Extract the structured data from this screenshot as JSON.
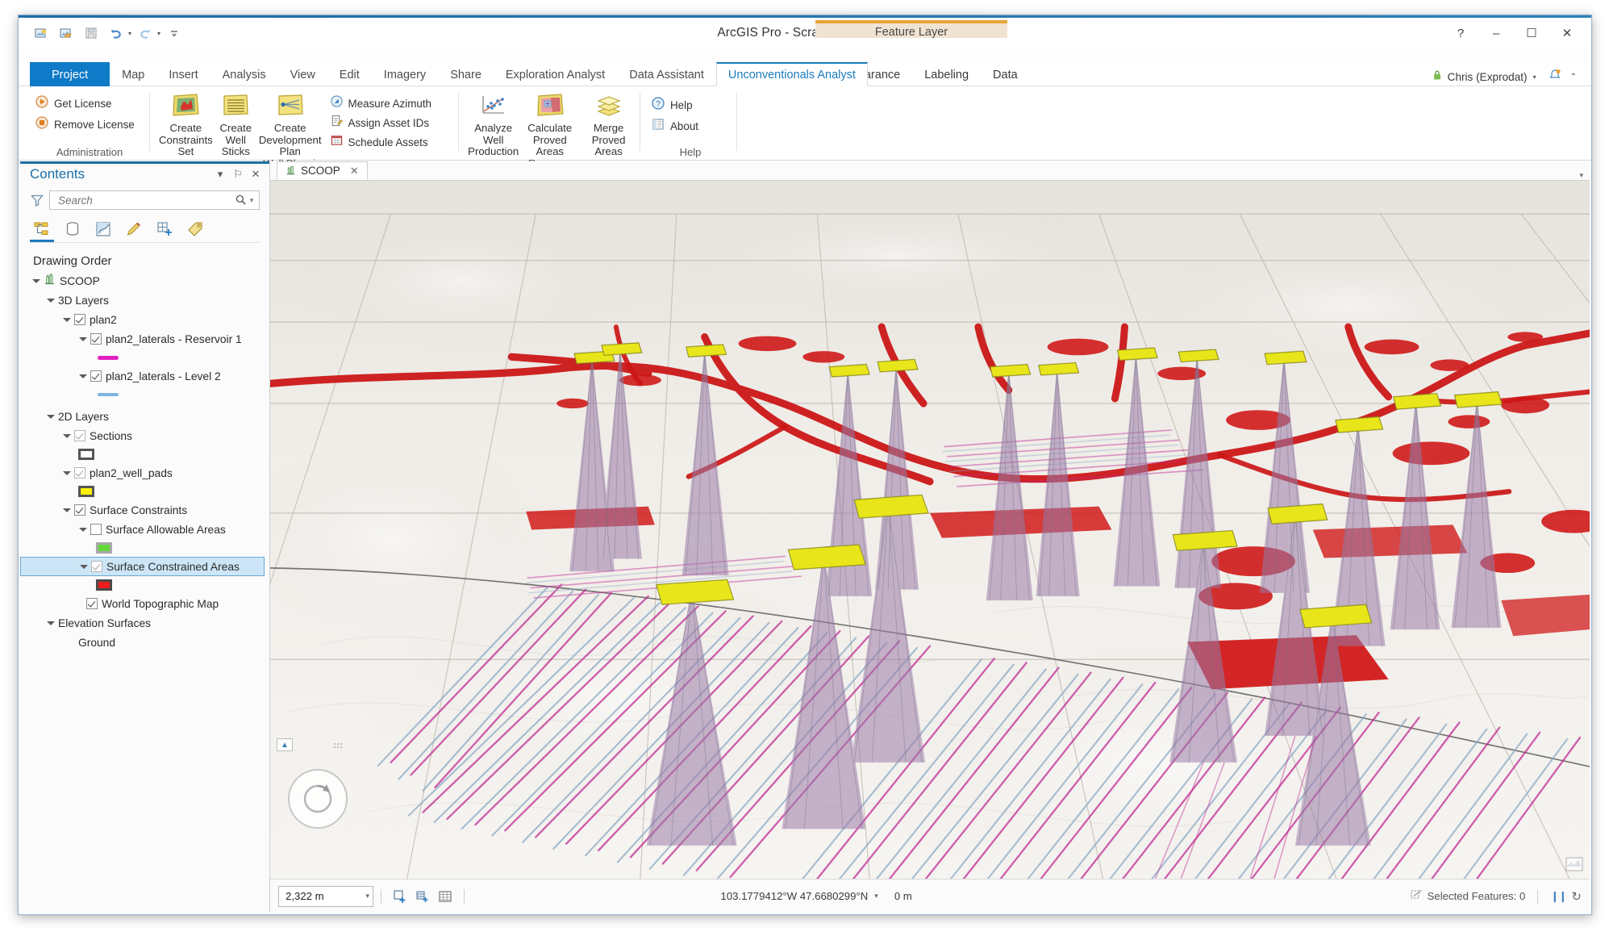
{
  "window": {
    "title": "ArcGIS Pro - Scratch - SCOOP",
    "help_glyph": "?",
    "minimize_glyph": "–",
    "maximize_glyph": "☐",
    "close_glyph": "✕",
    "account": "Chris (Exprodat)",
    "account_caret": "▾",
    "ribbon_collapse": "⌃"
  },
  "quick_access": [
    {
      "name": "new-project",
      "icon": "new-project-icon"
    },
    {
      "name": "open-project",
      "icon": "open-project-icon"
    },
    {
      "name": "save-project",
      "icon": "save-project-icon"
    },
    {
      "name": "undo",
      "icon": "undo-icon"
    },
    {
      "name": "redo",
      "icon": "redo-icon"
    },
    {
      "name": "customize-qat",
      "icon": "chevron-down-icon"
    }
  ],
  "tabs": [
    {
      "label": "Project",
      "state": "project"
    },
    {
      "label": "Map",
      "state": "normal"
    },
    {
      "label": "Insert",
      "state": "normal"
    },
    {
      "label": "Analysis",
      "state": "normal"
    },
    {
      "label": "View",
      "state": "normal"
    },
    {
      "label": "Edit",
      "state": "normal"
    },
    {
      "label": "Imagery",
      "state": "normal"
    },
    {
      "label": "Share",
      "state": "normal"
    },
    {
      "label": "Exploration Analyst",
      "state": "normal"
    },
    {
      "label": "Data Assistant",
      "state": "normal"
    },
    {
      "label": "Unconventionals Analyst",
      "state": "active"
    }
  ],
  "contextual": {
    "group_label": "Feature Layer",
    "tabs": [
      {
        "label": "Appearance"
      },
      {
        "label": "Labeling"
      },
      {
        "label": "Data"
      }
    ]
  },
  "ribbon": {
    "groups": [
      {
        "name": "Administration",
        "label": "Administration",
        "small_buttons": [
          {
            "label": "Get License",
            "icon": "play-circle-icon"
          },
          {
            "label": "Remove License",
            "icon": "stop-circle-icon"
          }
        ]
      },
      {
        "name": "Well Planning",
        "label": "Well Planning",
        "big_buttons": [
          {
            "label": "Create\nConstraints Set",
            "line1": "Create",
            "line2": "Constraints Set",
            "icon": "constraints-set-icon"
          },
          {
            "label": "Create\nWell Sticks",
            "line1": "Create",
            "line2": "Well Sticks",
            "icon": "well-sticks-icon"
          },
          {
            "label": "Create\nDevelopment Plan",
            "line1": "Create",
            "line2": "Development Plan",
            "icon": "development-plan-icon"
          }
        ],
        "small_buttons": [
          {
            "label": "Measure Azimuth",
            "icon": "compass-icon"
          },
          {
            "label": "Assign Asset IDs",
            "icon": "assign-asset-icon"
          },
          {
            "label": "Schedule Assets",
            "icon": "calendar-icon"
          }
        ]
      },
      {
        "name": "Reserves",
        "label": "Reserves",
        "big_buttons": [
          {
            "line1": "Analyze Well",
            "line2": "Production",
            "icon": "scatter-plot-icon"
          },
          {
            "line1": "Calculate",
            "line2": "Proved Areas",
            "icon": "proved-areas-icon"
          },
          {
            "line1": "Merge",
            "line2": "Proved Areas",
            "icon": "merge-layers-icon"
          }
        ]
      },
      {
        "name": "Help",
        "label": "Help",
        "small_buttons": [
          {
            "label": "Help",
            "icon": "help-circle-icon"
          },
          {
            "label": "About",
            "icon": "about-icon"
          }
        ]
      }
    ]
  },
  "contents": {
    "title": "Contents",
    "header_buttons": [
      {
        "name": "menu",
        "glyph": "▾"
      },
      {
        "name": "pin",
        "glyph": "⚐"
      },
      {
        "name": "close",
        "glyph": "✕"
      }
    ],
    "search": {
      "placeholder": "Search",
      "value": "",
      "filter_icon": "filter-icon",
      "search_icon": "search-icon",
      "caret": "▾"
    },
    "view_tabs": [
      {
        "name": "list-by-drawing-order",
        "icon": "drawing-order-icon",
        "selected": true
      },
      {
        "name": "list-by-data-source",
        "icon": "data-source-icon",
        "selected": false
      },
      {
        "name": "list-by-selection",
        "icon": "selection-icon",
        "selected": false
      },
      {
        "name": "list-by-editing",
        "icon": "editing-icon",
        "selected": false
      },
      {
        "name": "list-by-snapping",
        "icon": "snapping-icon",
        "selected": false
      },
      {
        "name": "list-by-labeling",
        "icon": "labeling-icon",
        "selected": false
      }
    ],
    "heading": "Drawing Order",
    "tree": [
      {
        "id": "scoop",
        "label": "SCOOP",
        "indent": 0,
        "arrow": "open",
        "check": "none",
        "icon": "map-scene-icon",
        "selected": false
      },
      {
        "id": "3dlayers",
        "label": "3D Layers",
        "indent": 1,
        "arrow": "open",
        "check": "none",
        "icon": "none",
        "selected": false
      },
      {
        "id": "plan2",
        "label": "plan2",
        "indent": 2,
        "arrow": "open",
        "check": "on",
        "icon": "none",
        "selected": false
      },
      {
        "id": "plan2_res1",
        "label": "plan2_laterals - Reservoir 1",
        "indent": 3,
        "arrow": "open",
        "check": "on",
        "icon": "none",
        "selected": false
      },
      {
        "id": "sw_res1",
        "label": "",
        "indent": 4,
        "swatch": "line",
        "color": "#e321c2",
        "selected": false
      },
      {
        "id": "plan2_lvl2",
        "label": "plan2_laterals - Level 2",
        "indent": 3,
        "arrow": "open",
        "check": "on",
        "icon": "none",
        "selected": false
      },
      {
        "id": "sw_lvl2",
        "label": "",
        "indent": 4,
        "swatch": "line",
        "color": "#7fb6e0",
        "selected": false
      },
      {
        "id": "2dlayers",
        "label": "2D Layers",
        "indent": 1,
        "arrow": "open",
        "check": "none",
        "icon": "none",
        "selected": false
      },
      {
        "id": "sections",
        "label": "Sections",
        "indent": 2,
        "arrow": "open",
        "check": "greyon",
        "icon": "none",
        "selected": false
      },
      {
        "id": "sw_sections",
        "label": "",
        "indent": 3,
        "swatch": "box",
        "color": "#ffffff",
        "border": "#555555",
        "selected": false
      },
      {
        "id": "wellpads",
        "label": "plan2_well_pads",
        "indent": 2,
        "arrow": "open",
        "check": "greyon",
        "icon": "none",
        "selected": false
      },
      {
        "id": "sw_wellpads",
        "label": "",
        "indent": 3,
        "swatch": "fill",
        "color": "#fbf10a",
        "border": "#555555",
        "selected": false
      },
      {
        "id": "surfconstraints",
        "label": "Surface Constraints",
        "indent": 2,
        "arrow": "open",
        "check": "on",
        "icon": "none",
        "selected": false
      },
      {
        "id": "allowable",
        "label": "Surface Allowable Areas",
        "indent": 3,
        "arrow": "open",
        "check": "off",
        "icon": "none",
        "selected": false
      },
      {
        "id": "sw_allowable",
        "label": "",
        "indent": 4,
        "swatch": "fill",
        "color": "#62d83c",
        "border": "#9e9e9e",
        "selected": false
      },
      {
        "id": "constrained",
        "label": "Surface Constrained Areas",
        "indent": 3,
        "arrow": "open",
        "check": "greyon",
        "icon": "none",
        "selected": true
      },
      {
        "id": "sw_constrained",
        "label": "",
        "indent": 4,
        "swatch": "fill",
        "color": "#f01d1d",
        "border": "#4a4a4a",
        "selected": false
      },
      {
        "id": "worldtopo",
        "label": "World Topographic Map",
        "indent": 3,
        "arrow": "none",
        "check": "on",
        "icon": "none",
        "selected": false
      },
      {
        "id": "elevsurfaces",
        "label": "Elevation Surfaces",
        "indent": 1,
        "arrow": "open",
        "check": "none",
        "icon": "none",
        "selected": false
      },
      {
        "id": "ground",
        "label": "Ground",
        "indent": 2,
        "arrow": "none",
        "check": "none",
        "icon": "none",
        "selected": false
      }
    ]
  },
  "view": {
    "tab_label": "SCOOP",
    "tab_icon": "scene-icon",
    "tab_close": "✕",
    "panel_caret": "▾"
  },
  "statusbar": {
    "scale": "2,322 m",
    "scale_caret": "▾",
    "tools": [
      {
        "name": "add-data",
        "icon": "add-data-icon"
      },
      {
        "name": "select-by-attributes",
        "icon": "select-attributes-icon"
      },
      {
        "name": "open-table",
        "icon": "table-icon"
      }
    ],
    "coordinates": "103.1779412°W 47.6680299°N",
    "coord_caret": "▾",
    "elevation": "0 m",
    "selected_features": "Selected Features: 0",
    "pause_glyph": "❙❙",
    "refresh_glyph": "↻"
  },
  "colors": {
    "accent": "#0f7ac7",
    "active_tab": "#1a7bbd",
    "contextual": "#e8a33d",
    "lateral_reservoir1": "#e321c2",
    "lateral_level2": "#7fb6e0",
    "well_pad": "#fbf10a",
    "constrained_area": "#e01b1b",
    "allowable_area": "#62d83c",
    "well_stick": "#9b7ba8",
    "selection_row": "#cde6f7"
  },
  "map": {
    "terrain_base": "#efece7",
    "grid_line": "#c8c4bd",
    "road": "#cf1b1b"
  }
}
